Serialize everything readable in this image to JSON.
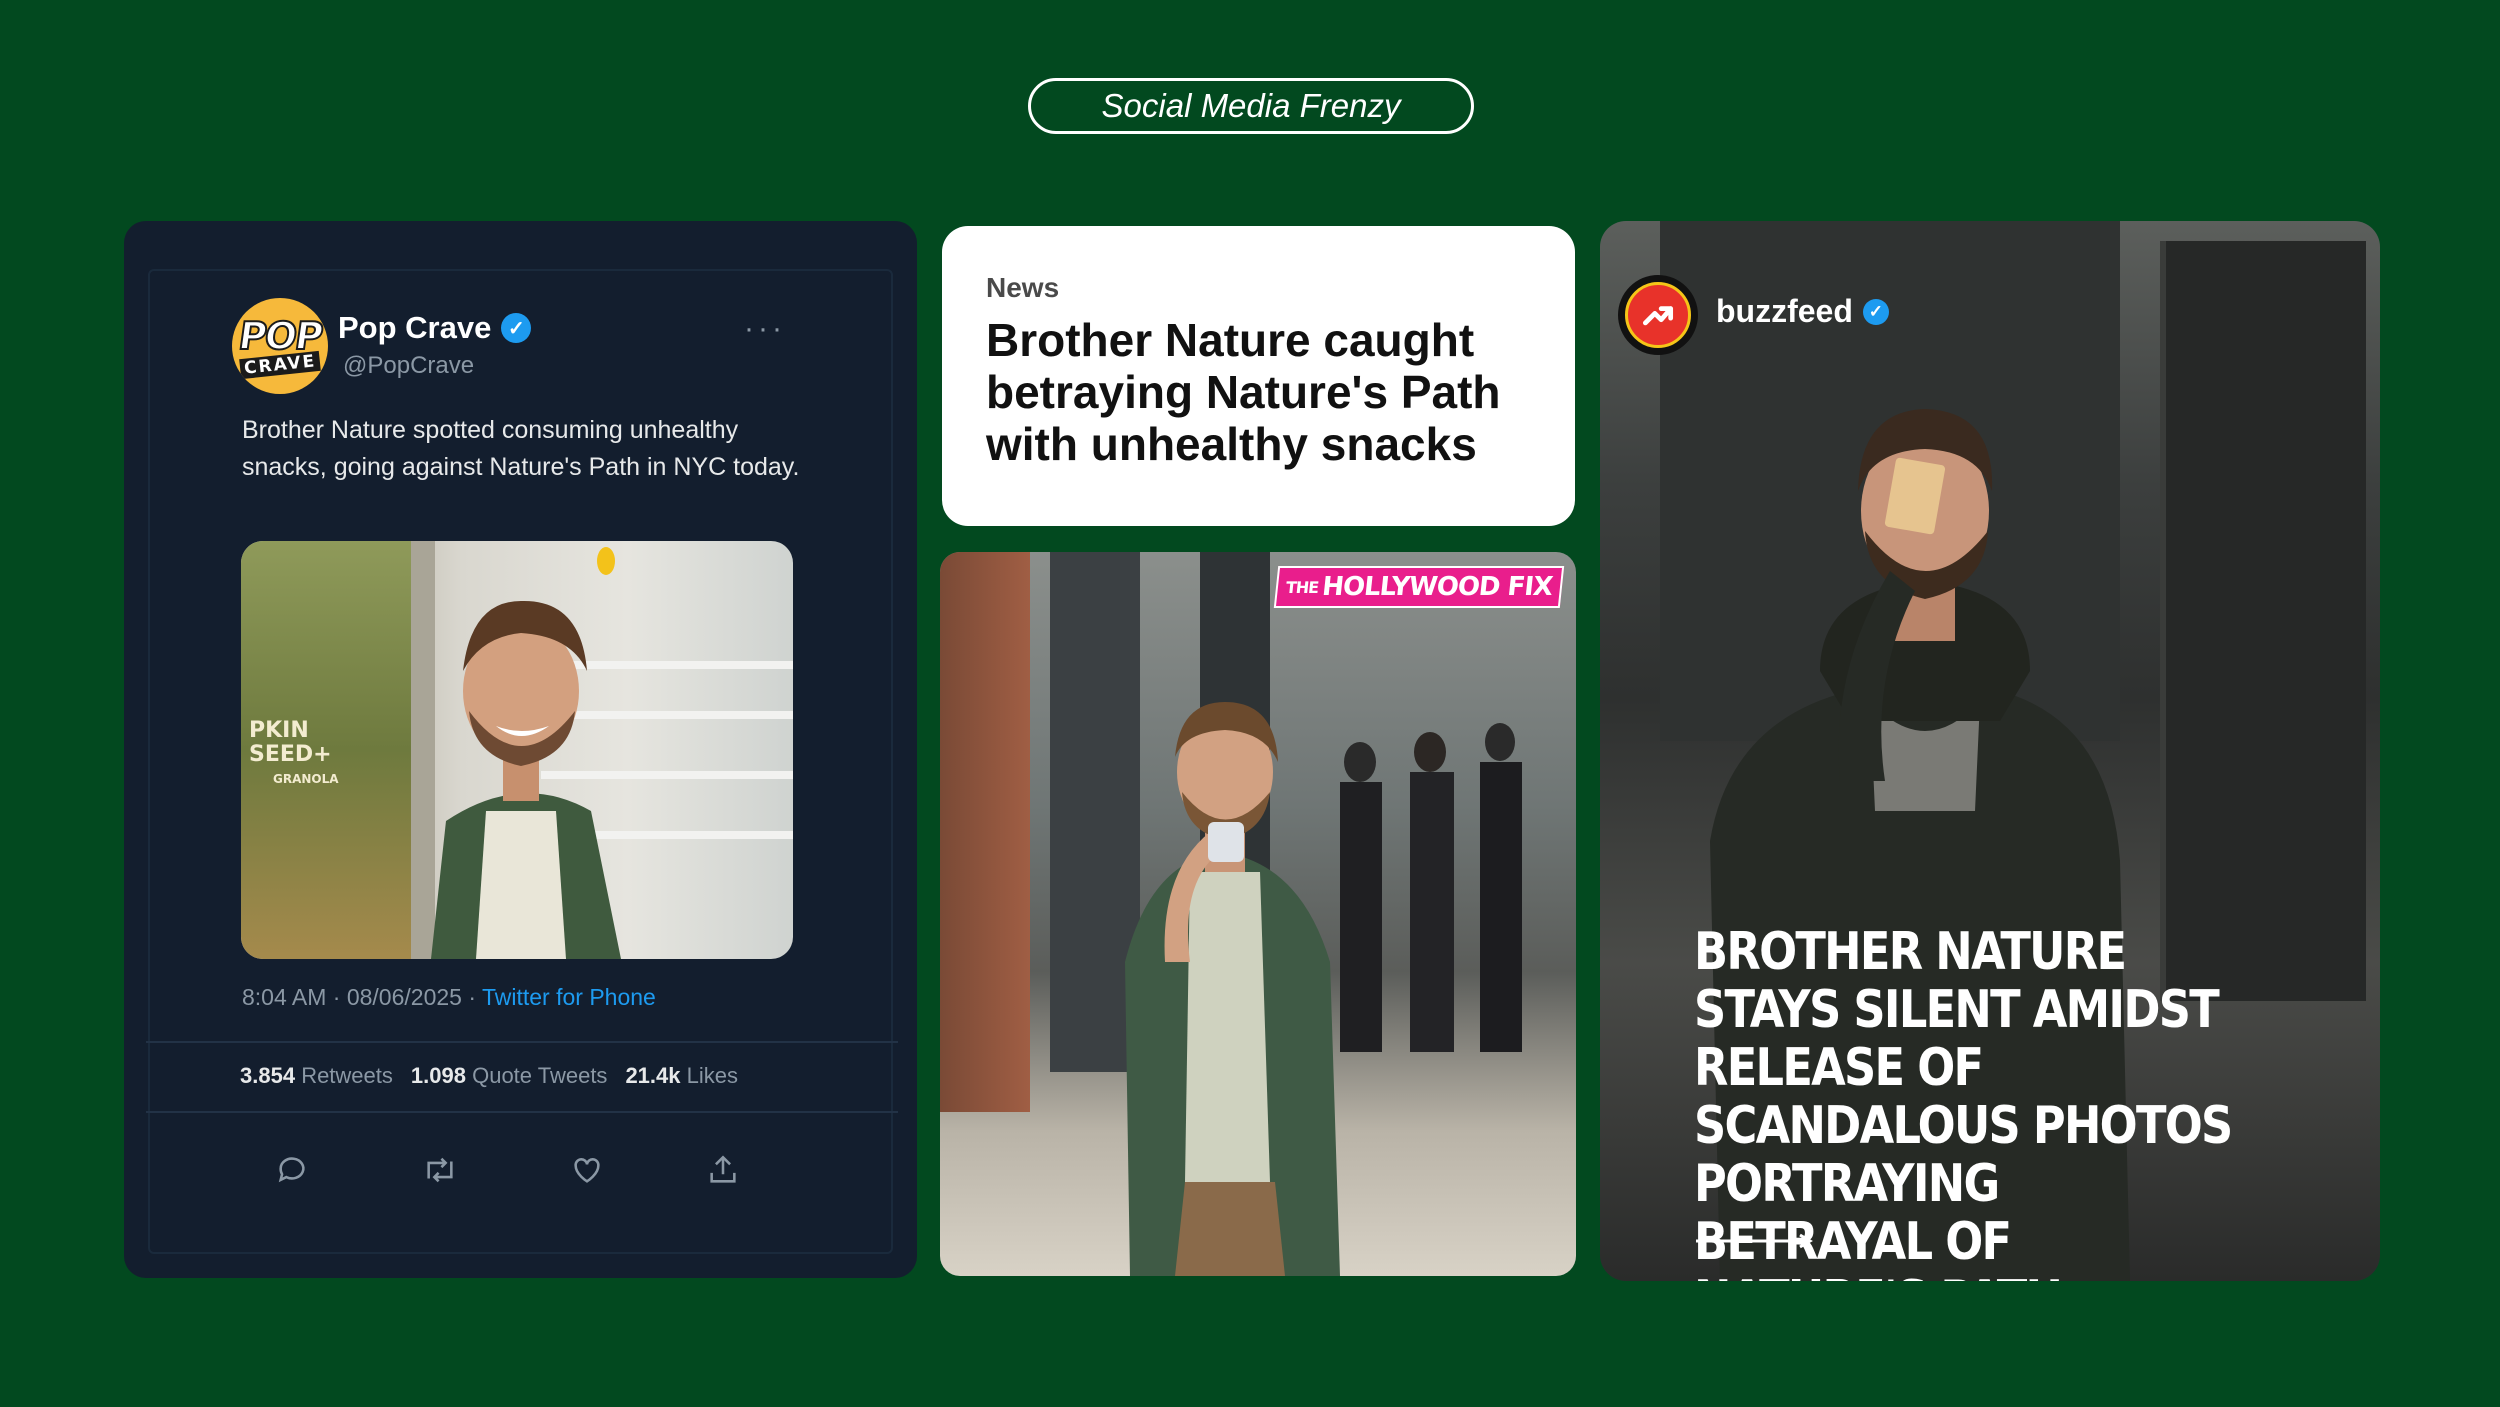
{
  "slide": {
    "title": "Social Media Frenzy",
    "background_color": "#02491f"
  },
  "tweet": {
    "display_name": "Pop Crave",
    "handle": "@PopCrave",
    "avatar_text_top": "POP",
    "avatar_text_bottom": "CRAVE",
    "text": "Brother Nature spotted consuming unhealthy snacks, going against Nature's Path in NYC today.",
    "meta_time": "8:04 AM · 08/06/2025 · ",
    "meta_source": "Twitter for Phone",
    "stats": {
      "retweets_count": "3.854",
      "retweets_label": "Retweets",
      "quote_count": "1.098",
      "quote_label": "Quote Tweets",
      "likes_count": "21.4k",
      "likes_label": "Likes"
    },
    "photo_package_text": "PKIN SEED+",
    "photo_package_sub": "GRANOLA"
  },
  "news": {
    "label": "News",
    "headline": "Brother Nature caught betraying Nature's Path with unhealthy snacks"
  },
  "hollywood": {
    "logo_small": "THE",
    "logo_main": "HOLLYWOOD FIX"
  },
  "buzzfeed": {
    "account_name": "buzzfeed",
    "headline": "BROTHER NATURE STAYS SILENT AMIDST RELEASE OF SCANDALOUS PHOTOS PORTRAYING BETRAYAL OF NATURE'S PATH"
  },
  "icons": {
    "verified": "verified-badge-icon",
    "more": "more-dots-icon",
    "reply": "reply-icon",
    "retweet": "retweet-icon",
    "like": "heart-icon",
    "share": "share-icon",
    "trending": "trending-arrow-icon"
  }
}
